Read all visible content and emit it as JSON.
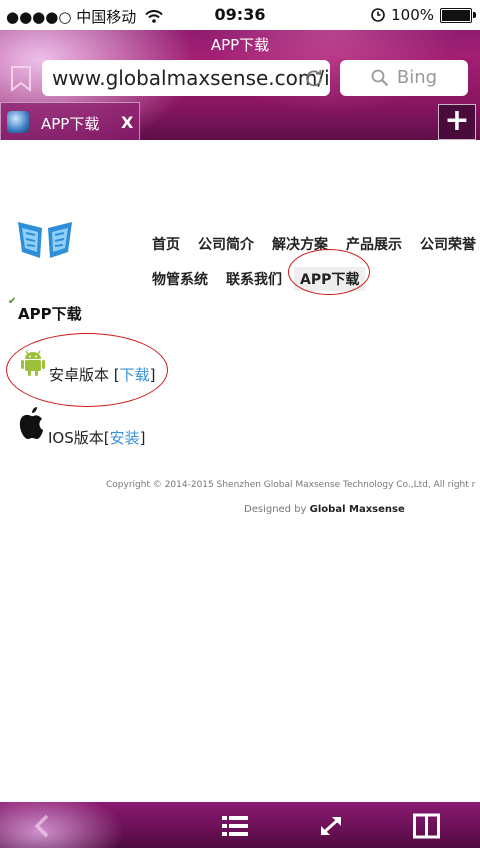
{
  "status_bar": {
    "carrier": "●●●●○ 中国移动",
    "time": "09:36",
    "battery": "100%"
  },
  "browser": {
    "page_title": "APP下载",
    "url": "www.globalmaxsense.com/i...",
    "search_placeholder": "Bing",
    "tab": {
      "title": "APP下载",
      "close": "X"
    },
    "new_tab": "+"
  },
  "site": {
    "nav_row1": [
      "首页",
      "公司简介",
      "解决方案",
      "产品展示",
      "公司荣誉"
    ],
    "nav_row2": [
      "物管系统",
      "联系我们",
      "APP下载"
    ],
    "section_heading": "APP下载",
    "android": {
      "label": "安卓版本 [",
      "link": "下载",
      "suffix": "]"
    },
    "ios": {
      "label": "IOS版本[",
      "link": "安装",
      "suffix": "]"
    },
    "copyright": "Copyright © 2014-2015 Shenzhen Global Maxsense Technology Co.,Ltd, All right r",
    "designed_by_label": "Designed by",
    "designed_by_name": "Global Maxsense"
  },
  "colors": {
    "accent_magenta": "#a21f74",
    "link_blue": "#3a92d9",
    "annotation_red": "#d01818",
    "android_green": "#9bc13c"
  },
  "icons": [
    "wifi-icon",
    "alarm-icon",
    "battery-icon",
    "bookmark-icon",
    "reload-icon",
    "search-icon",
    "favicon",
    "logo",
    "android-icon",
    "apple-icon",
    "back-icon",
    "list-icon",
    "fullscreen-icon",
    "split-view-icon"
  ]
}
